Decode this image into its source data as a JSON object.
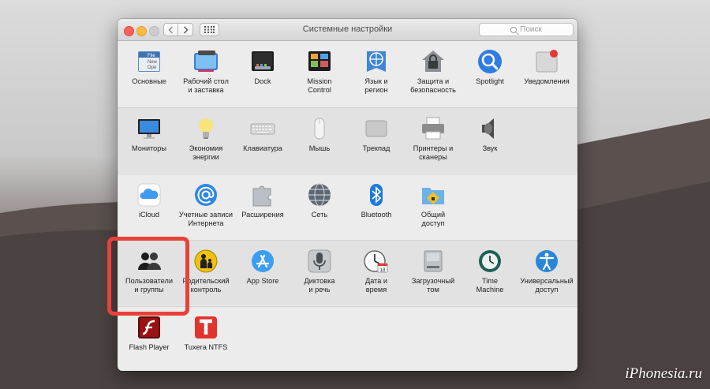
{
  "window": {
    "title": "Системные настройки",
    "search_placeholder": "Поиск"
  },
  "rows": [
    [
      {
        "label": "Основные",
        "icon": "general-icon"
      },
      {
        "label": "Рабочий стол\nи заставка",
        "icon": "desktop-icon"
      },
      {
        "label": "Dock",
        "icon": "dock-icon"
      },
      {
        "label": "Mission\nControl",
        "icon": "mission-control-icon"
      },
      {
        "label": "Язык и\nрегион",
        "icon": "language-icon"
      },
      {
        "label": "Защита и\nбезопасность",
        "icon": "security-icon"
      },
      {
        "label": "Spotlight",
        "icon": "spotlight-icon"
      },
      {
        "label": "Уведомления",
        "icon": "notifications-icon"
      }
    ],
    [
      {
        "label": "Мониторы",
        "icon": "displays-icon"
      },
      {
        "label": "Экономия\nэнергии",
        "icon": "energy-icon"
      },
      {
        "label": "Клавиатура",
        "icon": "keyboard-icon"
      },
      {
        "label": "Мышь",
        "icon": "mouse-icon"
      },
      {
        "label": "Трекпад",
        "icon": "trackpad-icon"
      },
      {
        "label": "Принтеры и\nсканеры",
        "icon": "printer-icon"
      },
      {
        "label": "Звук",
        "icon": "sound-icon"
      }
    ],
    [
      {
        "label": "iCloud",
        "icon": "icloud-icon"
      },
      {
        "label": "Учетные записи\nИнтернета",
        "icon": "internet-accounts-icon"
      },
      {
        "label": "Расширения",
        "icon": "extensions-icon"
      },
      {
        "label": "Сеть",
        "icon": "network-icon"
      },
      {
        "label": "Bluetooth",
        "icon": "bluetooth-icon"
      },
      {
        "label": "Общий\nдоступ",
        "icon": "sharing-icon"
      }
    ],
    [
      {
        "label": "Пользователи\nи группы",
        "icon": "users-icon"
      },
      {
        "label": "Родительский\nконтроль",
        "icon": "parental-icon"
      },
      {
        "label": "App Store",
        "icon": "appstore-icon"
      },
      {
        "label": "Диктовка\nи речь",
        "icon": "dictation-icon"
      },
      {
        "label": "Дата и\nвремя",
        "icon": "datetime-icon"
      },
      {
        "label": "Загрузочный\nтом",
        "icon": "startup-disk-icon"
      },
      {
        "label": "Time\nMachine",
        "icon": "time-machine-icon"
      },
      {
        "label": "Универсальный\nдоступ",
        "icon": "accessibility-icon"
      }
    ],
    [
      {
        "label": "Flash Player",
        "icon": "flash-icon"
      },
      {
        "label": "Tuxera NTFS",
        "icon": "tuxera-icon"
      }
    ]
  ],
  "general_icon_text": [
    "File",
    "New",
    "Ope"
  ],
  "calendar_day": "18",
  "watermark": "iPhonesia.ru",
  "colors": {
    "highlight": "#e8413a"
  }
}
